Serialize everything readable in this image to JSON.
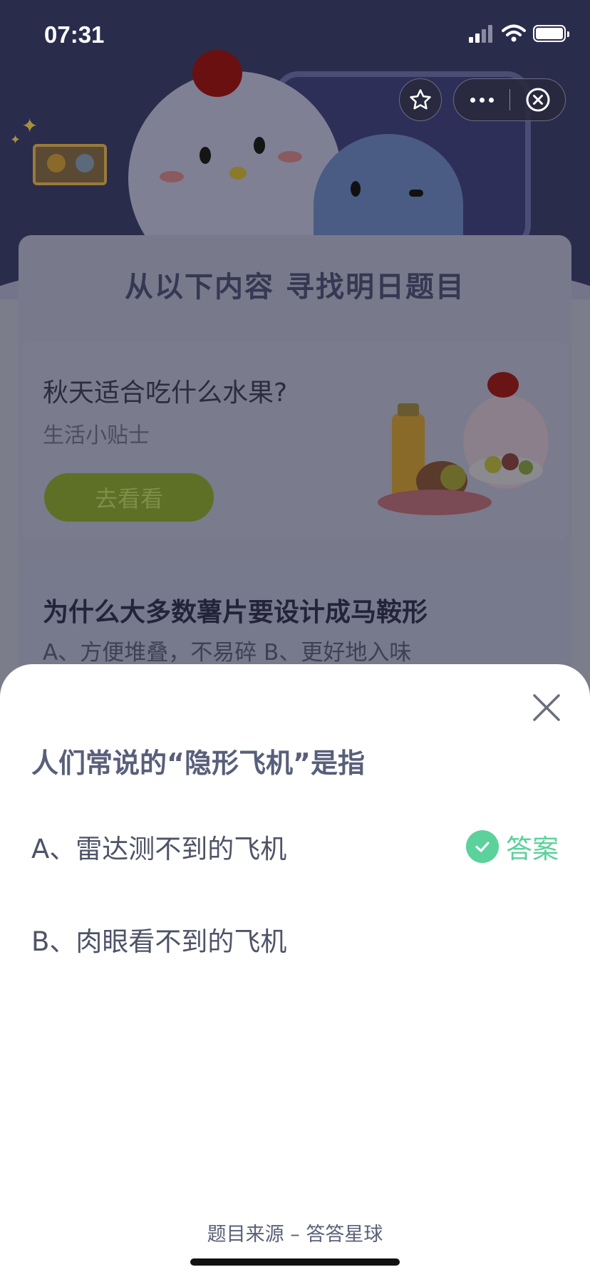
{
  "status_bar": {
    "time": "07:31"
  },
  "background": {
    "panel_title": "从以下内容 寻找明日题目",
    "card1": {
      "title": "秋天适合吃什么水果?",
      "subtitle": "生活小贴士",
      "button_label": "去看看"
    },
    "card2": {
      "title": "为什么大多数薯片要设计成马鞍形",
      "options_preview": "A、方便堆叠，不易碎    B、更好地入味"
    }
  },
  "sheet": {
    "question": "人们常说的“隐形飞机”是指",
    "options": [
      {
        "label": "A、雷达测不到的飞机",
        "is_answer": true,
        "answer_label": "答案"
      },
      {
        "label": "B、肉眼看不到的飞机",
        "is_answer": false
      }
    ],
    "source": "题目来源 – 答答星球"
  },
  "colors": {
    "accent_green": "#5bd19b",
    "question_text": "#585f7a",
    "hero_bg": "#2a2c4c"
  },
  "icons": [
    "star-icon",
    "more-icon",
    "close-circle-icon",
    "close-icon",
    "check-icon",
    "wifi-icon",
    "signal-icon",
    "battery-icon"
  ]
}
